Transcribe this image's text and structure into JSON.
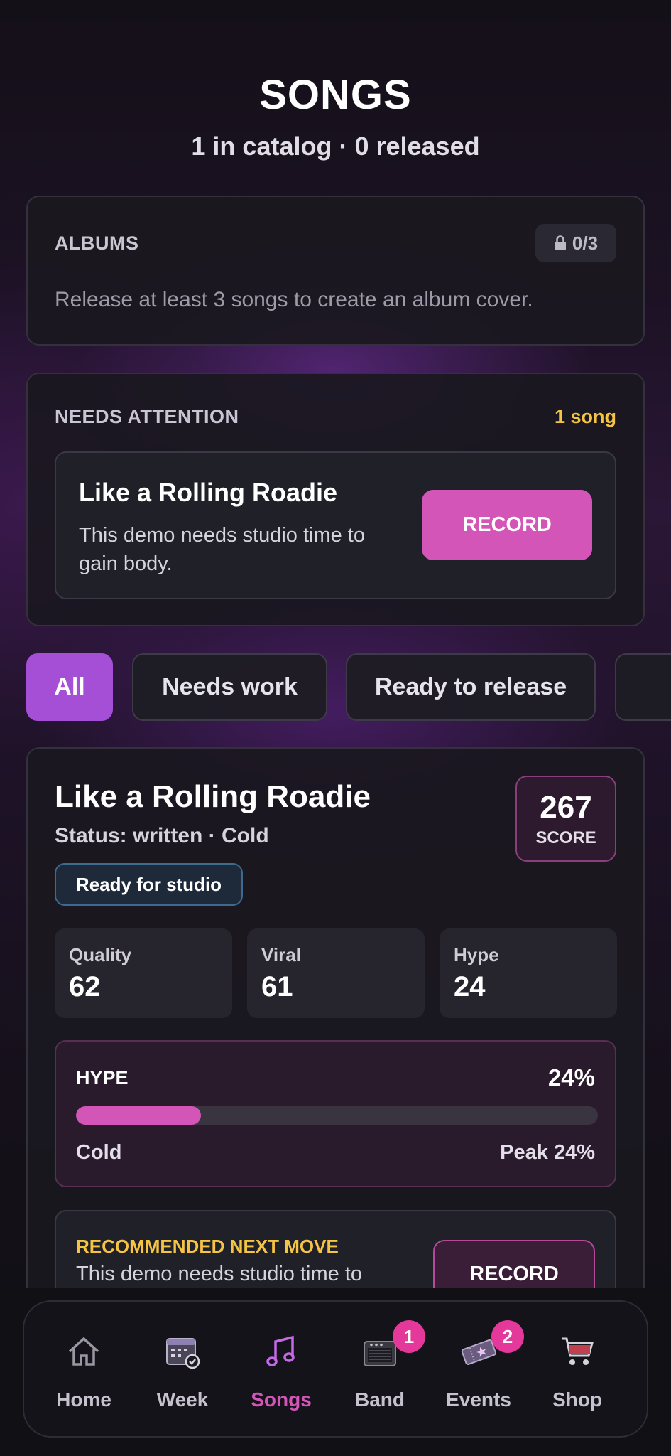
{
  "header": {
    "title": "SONGS",
    "subtitle": "1 in catalog · 0 released"
  },
  "albums": {
    "label": "ALBUMS",
    "lock_count": "0/3",
    "description": "Release at least 3 songs to create an album cover."
  },
  "attention": {
    "label": "NEEDS ATTENTION",
    "count": "1 song",
    "item": {
      "title": "Like a Rolling Roadie",
      "description": "This demo needs studio time to gain body.",
      "action": "RECORD"
    }
  },
  "filters": [
    "All",
    "Needs work",
    "Ready to release",
    ""
  ],
  "song": {
    "title": "Like a Rolling Roadie",
    "status": "Status: written · Cold",
    "score_value": "267",
    "score_label": "SCORE",
    "badge": "Ready for studio",
    "stats": [
      {
        "label": "Quality",
        "value": "62"
      },
      {
        "label": "Viral",
        "value": "61"
      },
      {
        "label": "Hype",
        "value": "24"
      }
    ],
    "hype": {
      "label": "HYPE",
      "percent_text": "24%",
      "level": 0.24,
      "state": "Cold",
      "peak": "Peak 24%"
    },
    "recommendation": {
      "label": "RECOMMENDED NEXT MOVE",
      "description": "This demo needs studio time to",
      "action": "RECORD"
    }
  },
  "nav": {
    "items": [
      {
        "label": "Home",
        "icon": "home-icon"
      },
      {
        "label": "Week",
        "icon": "calendar-icon"
      },
      {
        "label": "Songs",
        "icon": "music-note-icon"
      },
      {
        "label": "Band",
        "icon": "amplifier-icon",
        "badge": "1"
      },
      {
        "label": "Events",
        "icon": "ticket-icon",
        "badge": "2"
      },
      {
        "label": "Shop",
        "icon": "cart-icon"
      }
    ]
  },
  "colors": {
    "accent_pink": "#d455b8",
    "accent_purple": "#a44fd6",
    "warning_yellow": "#f5c443",
    "badge_pink": "#e4389a"
  }
}
